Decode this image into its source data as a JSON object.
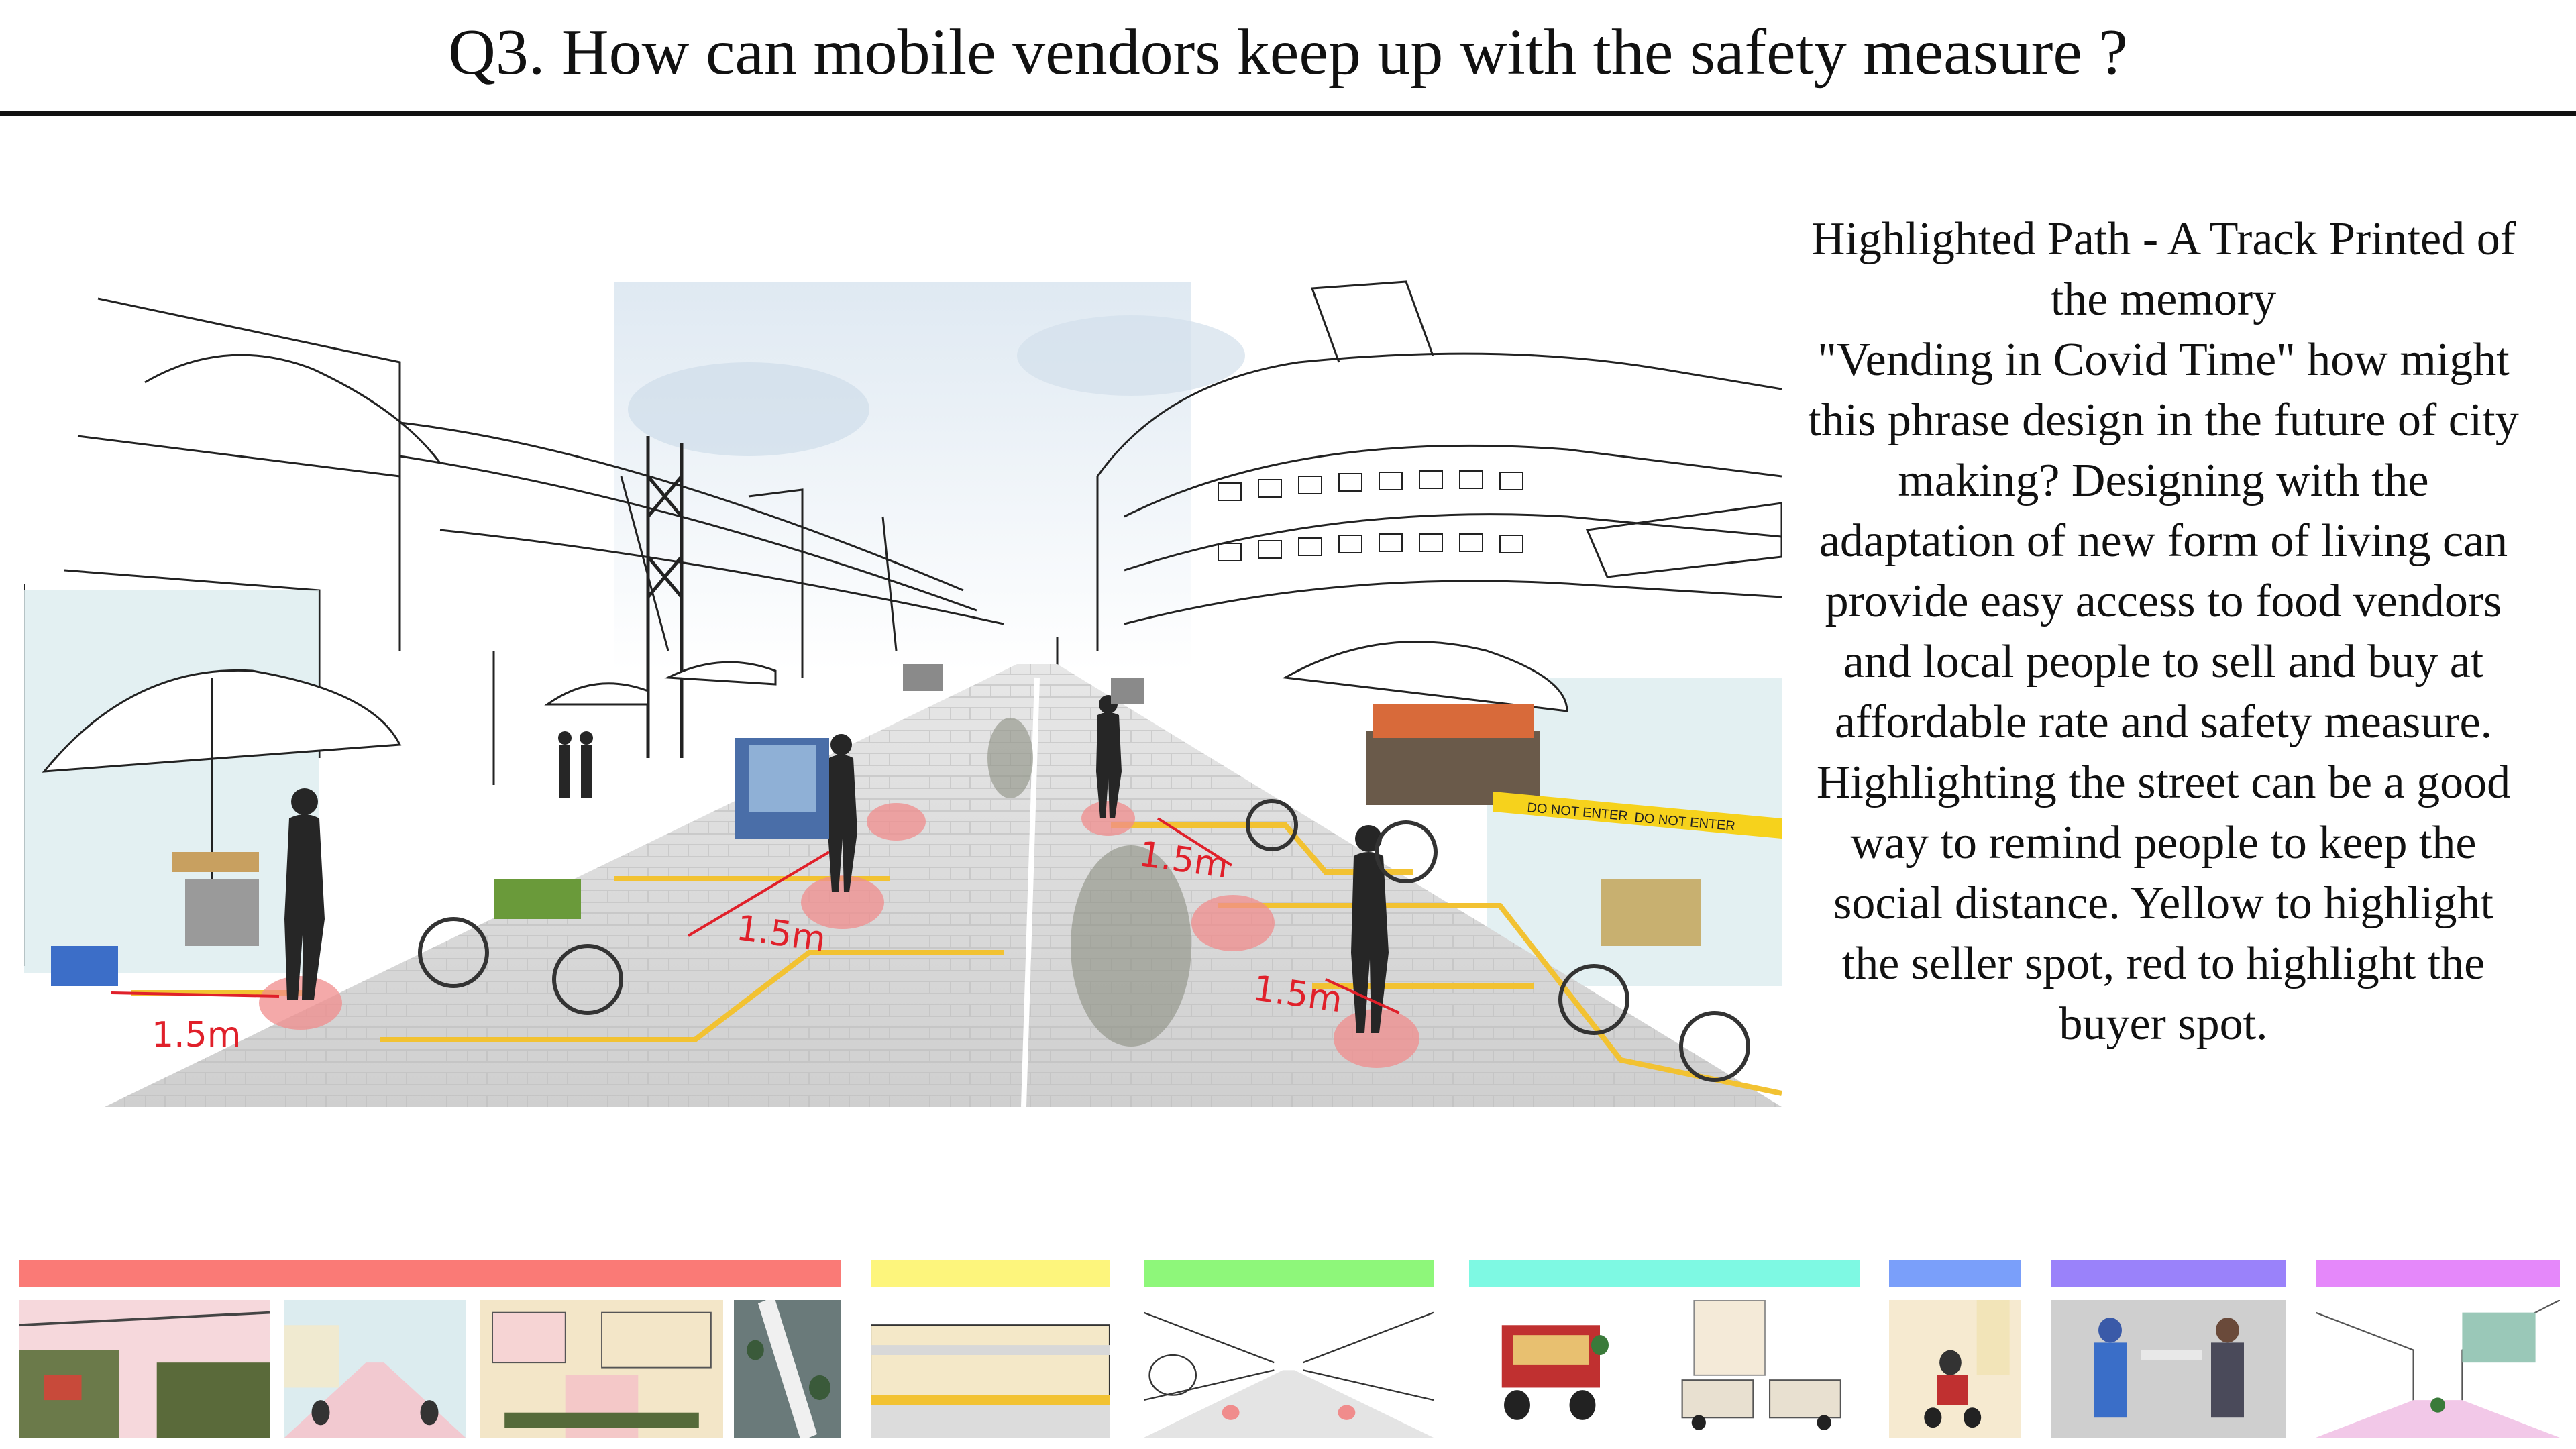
{
  "title": "Q3. How can mobile vendors keep up with the safety measure ?",
  "description_lines": [
    "Highlighted Path - A Track Printed of",
    "the memory",
    "\"Vending in Covid Time\" how might",
    "this phrase design in the future of city",
    "making? Designing with the",
    "adaptation of new form of living can",
    "provide easy access to food vendors",
    "and local people to sell and buy at",
    "affordable rate and safety measure.",
    "Highlighting the street can be a good",
    "way to remind people to keep the",
    "social distance. Yellow to highlight",
    "the seller spot, red to highlight the",
    "buyer spot."
  ],
  "distance_labels": [
    "1.5m",
    "1.5m",
    "1.5m",
    "1.5m"
  ],
  "tape_text": "DO NOT ENTER",
  "colors": {
    "seller_spot": "#f2c232",
    "buyer_spot": "#f08c8c",
    "measure_line": "#e0202a",
    "swatches": [
      "#fa7a76",
      "#fdf57c",
      "#8ef77a",
      "#7ef9e3",
      "#7a9ffa",
      "#9a82fa",
      "#e588fa"
    ]
  },
  "thumbnail_icons": [
    "market-photo-collage",
    "street-sketch",
    "building-sketch",
    "aerial-photo",
    "facade-sketch",
    "street-perspective",
    "tuk-tuk-cart",
    "tuk-tuk-sketch",
    "motorbike-vendor",
    "food-handover-photo",
    "street-corner-sketch"
  ]
}
